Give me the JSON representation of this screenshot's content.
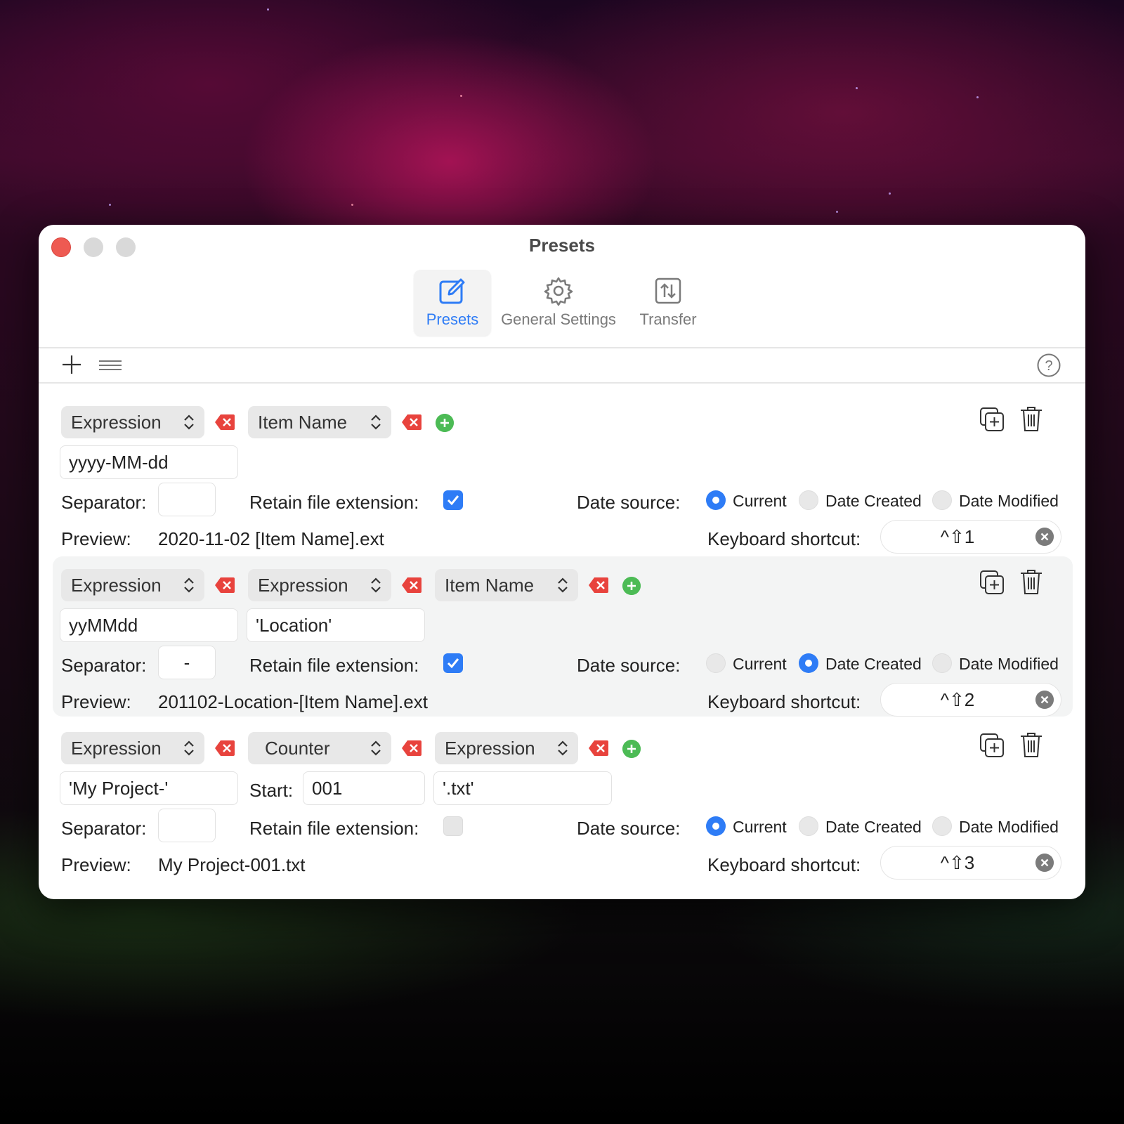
{
  "window": {
    "title": "Presets"
  },
  "tabs": [
    {
      "label": "Presets",
      "icon": "edit-icon",
      "active": true
    },
    {
      "label": "General Settings",
      "icon": "gear-icon",
      "active": false
    },
    {
      "label": "Transfer",
      "icon": "transfer-icon",
      "active": false
    }
  ],
  "toolbar": {
    "add_icon": "plus-icon",
    "menu_icon": "hamburger-icon",
    "help_icon": "help-icon"
  },
  "labels": {
    "separator": "Separator:",
    "retain": "Retain file extension:",
    "date_source": "Date source:",
    "preview": "Preview:",
    "shortcut": "Keyboard shortcut:",
    "start": "Start:",
    "current": "Current",
    "date_created": "Date Created",
    "date_modified": "Date Modified"
  },
  "presets": [
    {
      "tokens": [
        "Expression",
        "Item Name"
      ],
      "fields": [
        "yyyy-MM-dd"
      ],
      "separator": "",
      "retain_extension": true,
      "date_source": "Current",
      "preview": "2020-11-02 [Item Name].ext",
      "shortcut": "^⇧1"
    },
    {
      "tokens": [
        "Expression",
        "Expression",
        "Item Name"
      ],
      "fields": [
        "yyMMdd",
        "'Location'"
      ],
      "separator": "-",
      "retain_extension": true,
      "date_source": "Date Created",
      "preview": "201102-Location-[Item Name].ext",
      "shortcut": "^⇧2"
    },
    {
      "tokens": [
        "Expression",
        "Counter",
        "Expression"
      ],
      "fields": [
        "'My Project-'",
        "001",
        "'.txt'"
      ],
      "separator": "",
      "retain_extension": false,
      "date_source": "Current",
      "preview": "My Project-001.txt",
      "shortcut": "^⇧3"
    }
  ],
  "colors": {
    "accent": "#2e7cf6",
    "delete": "#e8433d",
    "add": "#4cbb55"
  }
}
